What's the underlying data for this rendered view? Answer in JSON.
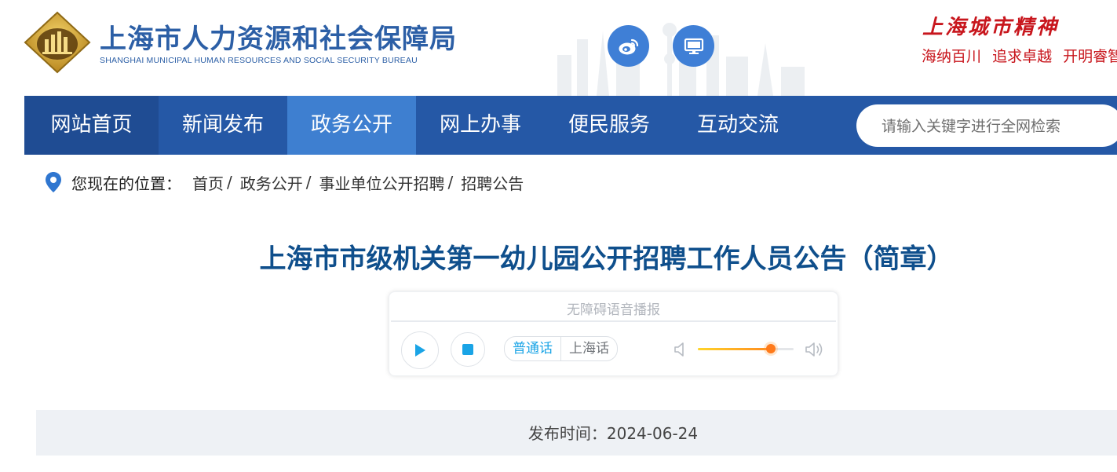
{
  "header": {
    "title": "上海市人力资源和社会保障局",
    "subtitle": "SHANGHAI MUNICIPAL HUMAN RESOURCES AND SOCIAL SECURITY BUREAU",
    "icons": [
      "weibo-icon",
      "monitor-icon"
    ],
    "spirit_title": "上海城市精神",
    "spirit_words": [
      "海纳百川",
      "追求卓越",
      "开明睿智"
    ]
  },
  "nav": {
    "items": [
      "网站首页",
      "新闻发布",
      "政务公开",
      "网上办事",
      "便民服务",
      "互动交流"
    ],
    "active": "政务公开",
    "search_placeholder": "请输入关键字进行全网检索"
  },
  "breadcrumb": {
    "label": "您现在的位置：",
    "items": [
      "首页",
      "政务公开",
      "事业单位公开招聘",
      "招聘公告"
    ],
    "separator": "/"
  },
  "article": {
    "title": "上海市市级机关第一幼儿园公开招聘工作人员公告（简章）",
    "publish_label": "发布时间：",
    "publish_date": "2024-06-24",
    "publish_text": "发布时间：2024-06-24"
  },
  "player": {
    "label": "无障碍语音播报",
    "dialects": [
      "普通话",
      "上海话"
    ],
    "active_dialect": "普通话",
    "volume": 0.76
  },
  "colors": {
    "nav_bg": "#2558a6",
    "nav_active": "#3e7fd0",
    "title_blue": "#0f4f8c",
    "spirit_red": "#c8161d",
    "accent_cyan": "#1aa4e6"
  }
}
